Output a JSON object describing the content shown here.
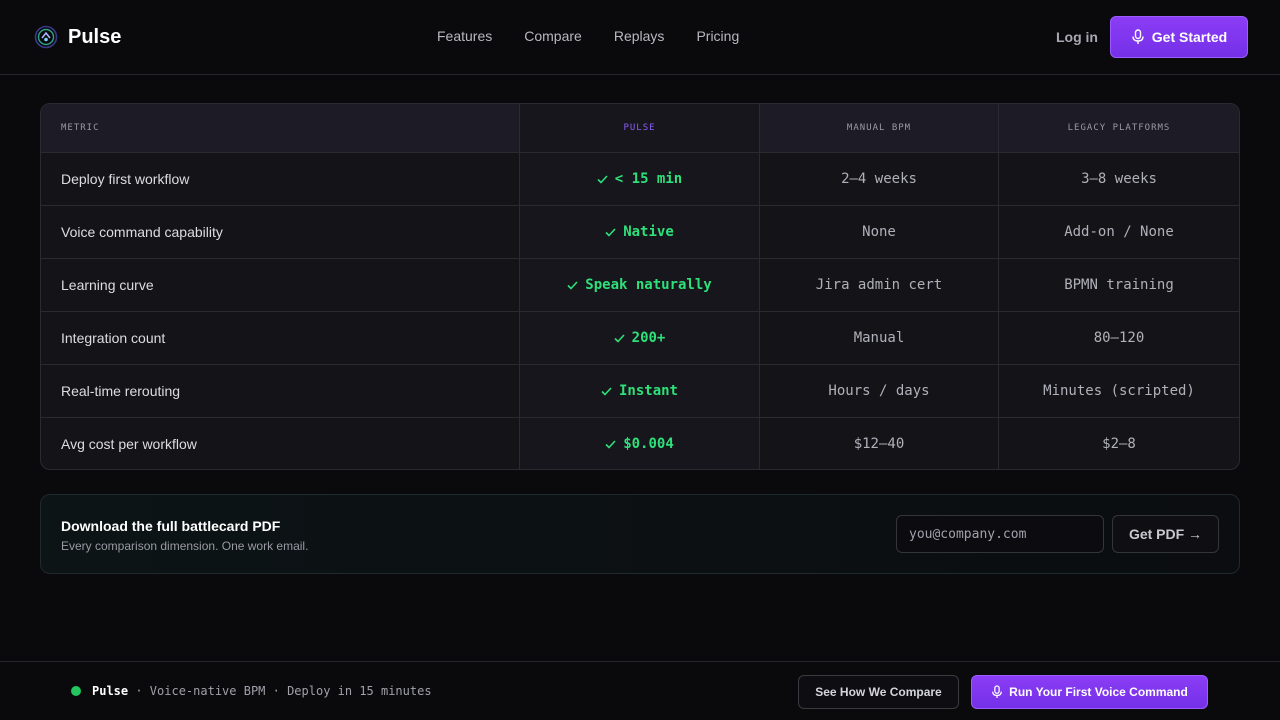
{
  "brand": {
    "name": "Pulse",
    "icon": "pulse-logo-icon"
  },
  "nav": {
    "links": [
      "Features",
      "Compare",
      "Replays",
      "Pricing"
    ]
  },
  "header": {
    "login_label": "Log in",
    "cta_label": "Get Started",
    "cta_icon": "microphone-icon"
  },
  "table": {
    "headers": [
      "METRIC",
      "PULSE",
      "MANUAL BPM",
      "LEGACY PLATFORMS"
    ],
    "rows": [
      {
        "metric": "Deploy first workflow",
        "pulse": "< 15 min",
        "manual": "2–4 weeks",
        "legacy": "3–8 weeks"
      },
      {
        "metric": "Voice command capability",
        "pulse": "Native",
        "manual": "None",
        "legacy": "Add-on / None"
      },
      {
        "metric": "Learning curve",
        "pulse": "Speak naturally",
        "manual": "Jira admin cert",
        "legacy": "BPMN training"
      },
      {
        "metric": "Integration count",
        "pulse": "200+",
        "manual": "Manual",
        "legacy": "80–120"
      },
      {
        "metric": "Real-time rerouting",
        "pulse": "Instant",
        "manual": "Hours / days",
        "legacy": "Minutes (scripted)"
      },
      {
        "metric": "Avg cost per workflow",
        "pulse": "$0.004",
        "manual": "$12–40",
        "legacy": "$2–8"
      }
    ]
  },
  "download": {
    "title": "Download the full battlecard PDF",
    "subtitle": "Every comparison dimension. One work email.",
    "email_placeholder": "you@company.com",
    "button_label": "Get PDF →"
  },
  "footer": {
    "brand": "Pulse",
    "tagline": " · Voice-native BPM · Deploy in 15 minutes",
    "compare_label": "See How We Compare",
    "run_label": "Run Your First Voice Command",
    "status_color": "#22c55e"
  },
  "colors": {
    "accent": "#7c3aed",
    "positive": "#2ee07a"
  }
}
